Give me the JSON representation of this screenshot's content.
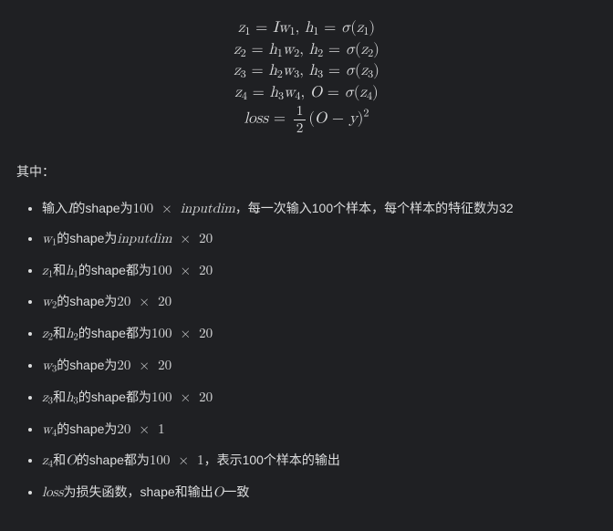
{
  "equations": {
    "line1": {
      "lhs_z": "z",
      "lhs_z_sub": "1",
      "eq": " = ",
      "Iw": "Iw",
      "Iw_sub": "1",
      "sep": ", ",
      "h": "h",
      "h_sub": "1",
      "eq2": " = ",
      "sigma": "σ",
      "open": "(",
      "arg": "z",
      "arg_sub": "1",
      "close": ")"
    },
    "line2": {
      "lhs_z": "z",
      "lhs_z_sub": "2",
      "eq": " = ",
      "hw_h": "h",
      "hw_h_sub": "1",
      "hw_w": "w",
      "hw_w_sub": "2",
      "sep": ", ",
      "h": "h",
      "h_sub": "2",
      "eq2": " = ",
      "sigma": "σ",
      "open": "(",
      "arg": "z",
      "arg_sub": "2",
      "close": ")"
    },
    "line3": {
      "lhs_z": "z",
      "lhs_z_sub": "3",
      "eq": " = ",
      "hw_h": "h",
      "hw_h_sub": "2",
      "hw_w": "w",
      "hw_w_sub": "3",
      "sep": ", ",
      "h": "h",
      "h_sub": "3",
      "eq2": " = ",
      "sigma": "σ",
      "open": "(",
      "arg": "z",
      "arg_sub": "3",
      "close": ")"
    },
    "line4": {
      "lhs_z": "z",
      "lhs_z_sub": "4",
      "eq": " = ",
      "hw_h": "h",
      "hw_h_sub": "3",
      "hw_w": "w",
      "hw_w_sub": "4",
      "sep": ", ",
      "O": "O",
      "eq2": " = ",
      "sigma": "σ",
      "open": "(",
      "arg": "z",
      "arg_sub": "4",
      "close": ")"
    },
    "line5": {
      "loss": "loss",
      "eq": " = ",
      "num": "1",
      "den": "2",
      "open": "(",
      "O": "O",
      "minus": " − ",
      "y": "y",
      "close": ")",
      "sq": "2"
    }
  },
  "lead": "其中：",
  "items": {
    "i0": {
      "pre": "输入",
      "I": "I",
      "mid": "的shape为",
      "a": "100",
      "times": " × ",
      "b": "inputdim",
      "post": "，每一次输入100个样本，每个样本的特征数为32"
    },
    "i1": {
      "w": "w",
      "w_sub": "1",
      "mid": "的shape为",
      "a": "inputdim",
      "times": " × ",
      "b": "20"
    },
    "i2": {
      "z": "z",
      "z_sub": "1",
      "and": "和",
      "h": "h",
      "h_sub": "1",
      "mid": "的shape都为",
      "a": "100",
      "times": " × ",
      "b": "20"
    },
    "i3": {
      "w": "w",
      "w_sub": "2",
      "mid": "的shape为",
      "a": "20",
      "times": " × ",
      "b": "20"
    },
    "i4": {
      "z": "z",
      "z_sub": "2",
      "and": "和",
      "h": "h",
      "h_sub": "2",
      "mid": "的shape都为",
      "a": "100",
      "times": " × ",
      "b": "20"
    },
    "i5": {
      "w": "w",
      "w_sub": "3",
      "mid": "的shape为",
      "a": "20",
      "times": " × ",
      "b": "20"
    },
    "i6": {
      "z": "z",
      "z_sub": "3",
      "and": "和",
      "h": "h",
      "h_sub": "3",
      "mid": "的shape都为",
      "a": "100",
      "times": " × ",
      "b": "20"
    },
    "i7": {
      "w": "w",
      "w_sub": "4",
      "mid": "的shape为",
      "a": "20",
      "times": " × ",
      "b": "1"
    },
    "i8": {
      "z": "z",
      "z_sub": "4",
      "and": "和",
      "O": "O",
      "mid": "的shape都为",
      "a": "100",
      "times": " × ",
      "b": "1",
      "post": "，表示100个样本的输出"
    },
    "i9": {
      "loss": "loss",
      "mid1": "为损失函数，shape和输出",
      "O": "O",
      "mid2": "一致"
    }
  }
}
